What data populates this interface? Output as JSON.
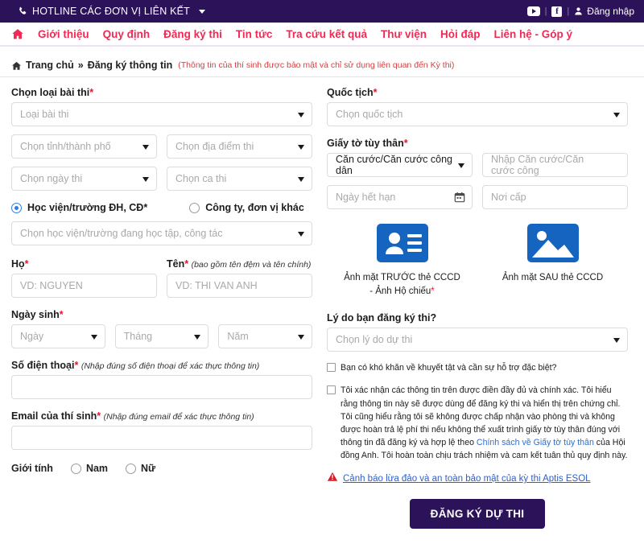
{
  "topbar": {
    "hotline": "HOTLINE CÁC ĐƠN VỊ LIÊN KẾT",
    "phone_icon": "phone-icon",
    "caret_icon": "chevron-down-icon",
    "youtube_icon": "youtube-icon",
    "facebook_icon": "facebook-icon",
    "facebook_glyph": "f",
    "user_icon": "user-icon",
    "login_label": "Đăng nhập",
    "separator": "|",
    "bg_color": "#2b1259"
  },
  "nav": {
    "home_icon": "home-icon",
    "accent_color": "#ef2b55",
    "items": [
      {
        "label": "Giới thiệu"
      },
      {
        "label": "Quy định"
      },
      {
        "label": "Đăng ký thi"
      },
      {
        "label": "Tin tức"
      },
      {
        "label": "Tra cứu kết quả"
      },
      {
        "label": "Thư viện"
      },
      {
        "label": "Hỏi đáp"
      },
      {
        "label": "Liên hệ - Góp ý"
      }
    ]
  },
  "breadcrumb": {
    "home_icon": "home-icon",
    "home_label": "Trang chủ",
    "separator": "»",
    "current": "Đăng ký thông tin",
    "note": "(Thông tin của thí sinh được bảo mật và chỉ sử dụng liên quan đến Kỳ thi)",
    "note_color": "#e03a3a"
  },
  "left": {
    "exam_type_label": "Chọn loại bài thi",
    "exam_type_placeholder": "Loại bài thi",
    "province_placeholder": "Chọn tỉnh/thành phố",
    "location_placeholder": "Chọn địa điểm thi",
    "exam_date_placeholder": "Chọn ngày thi",
    "exam_shift_placeholder": "Chọn ca thi",
    "org_radio_school": "Học viện/trường ĐH, CĐ",
    "org_radio_company": "Công ty, đơn vị khác",
    "school_placeholder": "Chọn học viện/trường đang học tập, công tác",
    "surname_label": "Họ",
    "surname_placeholder": "VD: NGUYEN",
    "givenname_label": "Tên",
    "givenname_hint": "(bao gồm tên đệm và tên chính)",
    "dob_label": "Ngày sinh",
    "dob_day_placeholder": "Ngày",
    "dob_month_placeholder": "Tháng",
    "dob_year_placeholder": "Năm",
    "givenname_placeholder": "VD: THI VAN ANH",
    "phone_label": "Số điện thoại",
    "phone_hint": "(Nhập đúng số điện thoại để xác thực thông tin)",
    "phone_value": "",
    "email_label": "Email của thí sinh",
    "email_hint": "(Nhập đúng email để xác thực thông tin)",
    "email_value": "",
    "gender_label": "Giới tính",
    "gender_male": "Nam",
    "gender_female": "Nữ",
    "required_mark": "*"
  },
  "right": {
    "nationality_label": "Quốc tịch",
    "nationality_placeholder": "Chọn quốc tịch",
    "id_doc_label": "Giấy tờ tùy thân",
    "id_type_value": "Căn cước/Căn cước công dân",
    "id_number_placeholder": "Nhập Căn cước/Căn cước công",
    "id_expiry_placeholder": "Ngày hết hạn",
    "id_issue_place_placeholder": "Nơi cấp",
    "calendar_icon": "calendar-icon",
    "upload_front_icon": "id-card-icon",
    "upload_front_label": "Ảnh mặt TRƯỚC thẻ CCCD - Ảnh Hộ chiếu",
    "upload_back_icon": "image-icon",
    "upload_back_label": "Ảnh mặt SAU thẻ CCCD",
    "upload_icon_color": "#1565c0",
    "reason_label": "Lý do bạn đăng ký thi?",
    "reason_placeholder": "Chọn lý do dự thi",
    "disability_checkbox": "Bạn có khó khăn về khuyết tật và cần sự hỗ trợ đặc biệt?",
    "terms_part1": "Tôi xác nhận các thông tin trên được điền đầy đủ và chính xác. Tôi hiểu rằng thông tin này sẽ được dùng để đăng ký thi và hiển thị trên chứng chỉ. Tôi cũng hiểu rằng tôi sẽ không được chấp nhận vào phòng thi và không được hoàn trả lệ phí thi nếu không thể xuất trình giấy tờ tùy thân đúng với thông tin đã đăng ký và hợp lệ theo ",
    "terms_link": "Chính sách về Giấy tờ tùy thân",
    "terms_part2": " của Hội đồng Anh. Tôi hoàn toàn chịu trách nhiệm và cam kết tuân thủ quy định này.",
    "warning_icon": "warning-triangle-icon",
    "warning_text": "Cảnh báo lừa đảo và an toàn bảo mật của kỳ thi Aptis ESOL",
    "warning_link_color": "#2f5fc4",
    "submit_label": "ĐĂNG KÝ DỰ THI",
    "submit_color": "#2b1259",
    "required_mark": "*"
  }
}
